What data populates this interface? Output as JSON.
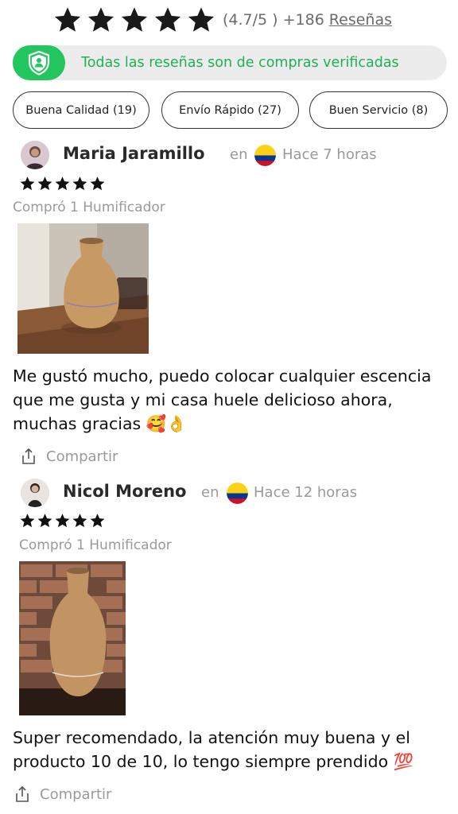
{
  "header": {
    "rating_text": "(4.7/5 ) +186",
    "reviews_link": "Reseñas"
  },
  "banner": {
    "text": "Todas las reseñas son de compras verificadas",
    "icon": "shield-user-icon",
    "accent": "#22c55e"
  },
  "filters": [
    {
      "label": "Buena Calidad (19)"
    },
    {
      "label": "Envío Rápido (27)"
    },
    {
      "label": "Buen Servicio (8)"
    }
  ],
  "reviews": [
    {
      "name": "Maria Jaramillo",
      "en": "en",
      "time": "Hace 7 horas",
      "country_flag": "colombia-flag-icon",
      "stars": 5,
      "bought": "Compró 1 Humificador",
      "text": "Me gustó mucho, puedo colocar cualquier escencia que me gusta y mi casa huele delicioso ahora, muchas gracias 🥰👌",
      "share": "Compartir"
    },
    {
      "name": "Nicol Moreno",
      "en": "en",
      "time": "Hace 12 horas",
      "country_flag": "colombia-flag-icon",
      "stars": 5,
      "bought": "Compró 1 Humificador",
      "text": "Super recomendado, la atención muy buena y el producto 10 de 10, lo tengo siempre prendido 💯",
      "share": "Compartir"
    }
  ],
  "colors": {
    "star": "#1a1a1a",
    "muted": "#9a9a9a",
    "verified_text": "#1fb154"
  }
}
